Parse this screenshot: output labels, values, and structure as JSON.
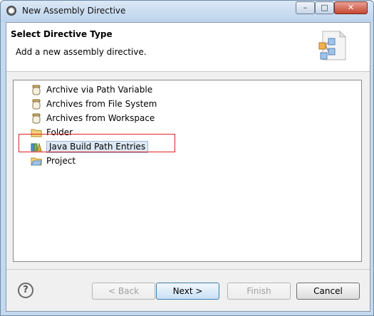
{
  "window": {
    "title": "New Assembly Directive",
    "minimize_glyph": "–",
    "maximize_glyph": "□",
    "close_glyph": "✕"
  },
  "header": {
    "title": "Select Directive Type",
    "description": "Add a new assembly directive."
  },
  "list": {
    "items": [
      {
        "label": "Archive via Path Variable",
        "icon": "jar-icon",
        "selected": false
      },
      {
        "label": "Archives from File System",
        "icon": "jar-icon",
        "selected": false
      },
      {
        "label": "Archives from Workspace",
        "icon": "jar-icon",
        "selected": false
      },
      {
        "label": "Folder",
        "icon": "folder-icon",
        "selected": false
      },
      {
        "label": "Java Build Path Entries",
        "icon": "library-icon",
        "selected": true
      },
      {
        "label": "Project",
        "icon": "project-folder-icon",
        "selected": false
      }
    ]
  },
  "buttons": {
    "help": "?",
    "back": "< Back",
    "next": "Next >",
    "finish": "Finish",
    "cancel": "Cancel"
  }
}
